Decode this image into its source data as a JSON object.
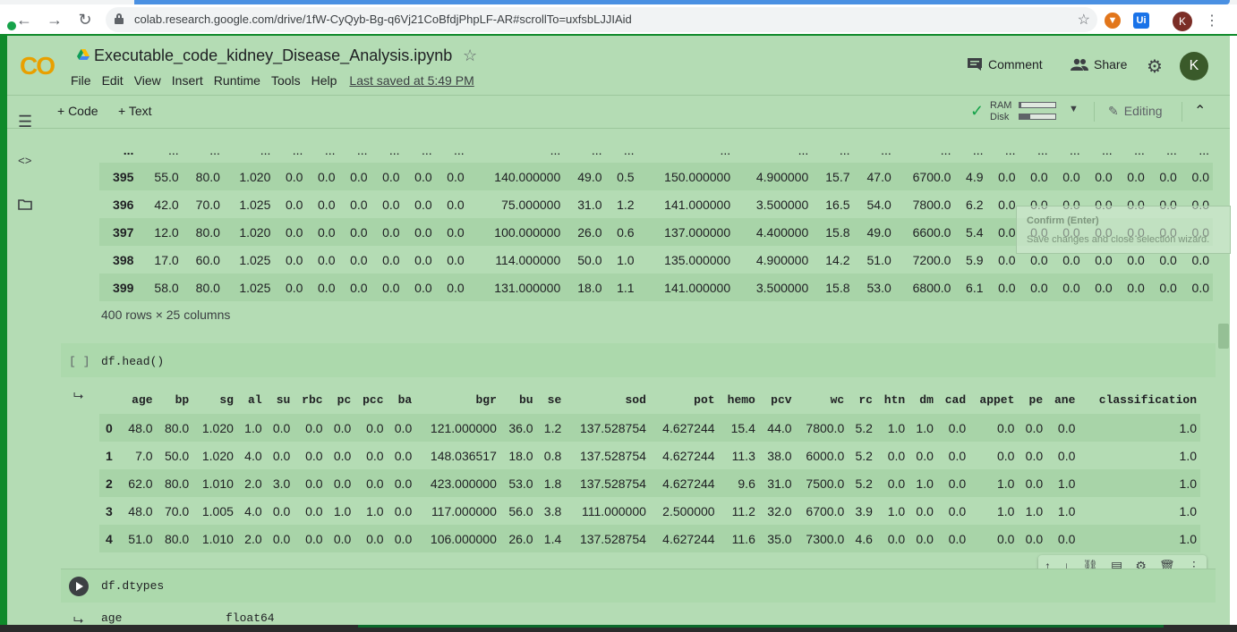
{
  "browser": {
    "url": "colab.research.google.com/drive/1fW-CyQyb-Bg-q6Vj21CoBfdjPhpLF-AR#scrollTo=uxfsbLJJIAid",
    "profile_initial": "K",
    "ext_ui_label": "Ui"
  },
  "header": {
    "logo": "CO",
    "title": "Executable_code_kidney_Disease_Analysis.ipynb",
    "menu": [
      "File",
      "Edit",
      "View",
      "Insert",
      "Runtime",
      "Tools",
      "Help"
    ],
    "last_saved": "Last saved at 5:49 PM",
    "comment_label": "Comment",
    "share_label": "Share",
    "avatar_initial": "K"
  },
  "toolbar": {
    "code_label": "+ Code",
    "text_label": "+ Text",
    "ram_label": "RAM",
    "disk_label": "Disk",
    "ram_fraction": 0.05,
    "disk_fraction": 0.3,
    "editing_label": "Editing"
  },
  "top_output": {
    "ellipsis_row": [
      "...",
      "...",
      "...",
      "...",
      "...",
      "...",
      "...",
      "...",
      "...",
      "...",
      "...",
      "...",
      "...",
      "...",
      "...",
      "...",
      "...",
      "...",
      "...",
      "...",
      "...",
      "...",
      "...",
      "...",
      "...",
      "..."
    ],
    "rows": [
      [
        "395",
        "55.0",
        "80.0",
        "1.020",
        "0.0",
        "0.0",
        "0.0",
        "0.0",
        "0.0",
        "0.0",
        "140.000000",
        "49.0",
        "0.5",
        "150.000000",
        "4.900000",
        "15.7",
        "47.0",
        "6700.0",
        "4.9",
        "0.0",
        "0.0",
        "0.0",
        "0.0",
        "0.0",
        "0.0",
        "0.0"
      ],
      [
        "396",
        "42.0",
        "70.0",
        "1.025",
        "0.0",
        "0.0",
        "0.0",
        "0.0",
        "0.0",
        "0.0",
        "75.000000",
        "31.0",
        "1.2",
        "141.000000",
        "3.500000",
        "16.5",
        "54.0",
        "7800.0",
        "6.2",
        "0.0",
        "0.0",
        "0.0",
        "0.0",
        "0.0",
        "0.0",
        "0.0"
      ],
      [
        "397",
        "12.0",
        "80.0",
        "1.020",
        "0.0",
        "0.0",
        "0.0",
        "0.0",
        "0.0",
        "0.0",
        "100.000000",
        "26.0",
        "0.6",
        "137.000000",
        "4.400000",
        "15.8",
        "49.0",
        "6600.0",
        "5.4",
        "0.0",
        "0.0",
        "0.0",
        "0.0",
        "0.0",
        "0.0",
        "0.0"
      ],
      [
        "398",
        "17.0",
        "60.0",
        "1.025",
        "0.0",
        "0.0",
        "0.0",
        "0.0",
        "0.0",
        "0.0",
        "114.000000",
        "50.0",
        "1.0",
        "135.000000",
        "4.900000",
        "14.2",
        "51.0",
        "7200.0",
        "5.9",
        "0.0",
        "0.0",
        "0.0",
        "0.0",
        "0.0",
        "0.0",
        "0.0"
      ],
      [
        "399",
        "58.0",
        "80.0",
        "1.025",
        "0.0",
        "0.0",
        "0.0",
        "0.0",
        "0.0",
        "0.0",
        "131.000000",
        "18.0",
        "1.1",
        "141.000000",
        "3.500000",
        "15.8",
        "53.0",
        "6800.0",
        "6.1",
        "0.0",
        "0.0",
        "0.0",
        "0.0",
        "0.0",
        "0.0",
        "0.0"
      ]
    ],
    "rows_note": "400 rows × 25 columns"
  },
  "head_cell": {
    "bracket": "[ ]",
    "code": "df.head()",
    "columns": [
      "",
      "age",
      "bp",
      "sg",
      "al",
      "su",
      "rbc",
      "pc",
      "pcc",
      "ba",
      "bgr",
      "bu",
      "se",
      "sod",
      "pot",
      "hemo",
      "pcv",
      "wc",
      "rc",
      "htn",
      "dm",
      "cad",
      "appet",
      "pe",
      "ane",
      "classification"
    ],
    "rows": [
      [
        "0",
        "48.0",
        "80.0",
        "1.020",
        "1.0",
        "0.0",
        "0.0",
        "0.0",
        "0.0",
        "0.0",
        "121.000000",
        "36.0",
        "1.2",
        "137.528754",
        "4.627244",
        "15.4",
        "44.0",
        "7800.0",
        "5.2",
        "1.0",
        "1.0",
        "0.0",
        "0.0",
        "0.0",
        "0.0",
        "1.0"
      ],
      [
        "1",
        "7.0",
        "50.0",
        "1.020",
        "4.0",
        "0.0",
        "0.0",
        "0.0",
        "0.0",
        "0.0",
        "148.036517",
        "18.0",
        "0.8",
        "137.528754",
        "4.627244",
        "11.3",
        "38.0",
        "6000.0",
        "5.2",
        "0.0",
        "0.0",
        "0.0",
        "0.0",
        "0.0",
        "0.0",
        "1.0"
      ],
      [
        "2",
        "62.0",
        "80.0",
        "1.010",
        "2.0",
        "3.0",
        "0.0",
        "0.0",
        "0.0",
        "0.0",
        "423.000000",
        "53.0",
        "1.8",
        "137.528754",
        "4.627244",
        "9.6",
        "31.0",
        "7500.0",
        "5.2",
        "0.0",
        "1.0",
        "0.0",
        "1.0",
        "0.0",
        "1.0",
        "1.0"
      ],
      [
        "3",
        "48.0",
        "70.0",
        "1.005",
        "4.0",
        "0.0",
        "0.0",
        "1.0",
        "1.0",
        "0.0",
        "117.000000",
        "56.0",
        "3.8",
        "111.000000",
        "2.500000",
        "11.2",
        "32.0",
        "6700.0",
        "3.9",
        "1.0",
        "0.0",
        "0.0",
        "1.0",
        "1.0",
        "1.0",
        "1.0"
      ],
      [
        "4",
        "51.0",
        "80.0",
        "1.010",
        "2.0",
        "0.0",
        "0.0",
        "0.0",
        "0.0",
        "0.0",
        "106.000000",
        "26.0",
        "1.4",
        "137.528754",
        "4.627244",
        "11.6",
        "35.0",
        "7300.0",
        "4.6",
        "0.0",
        "0.0",
        "0.0",
        "0.0",
        "0.0",
        "0.0",
        "1.0"
      ]
    ]
  },
  "dtypes_cell": {
    "code": "df.dtypes",
    "first_row_name": "age",
    "first_row_type": "float64"
  },
  "tooltip": {
    "title": "Confirm (Enter)",
    "text": "Save changes and close selection wizard."
  },
  "colors": {
    "background": "#b4dcb4",
    "stripe": "#a8d4a8",
    "frame_green": "#0f8a2a",
    "colab_orange": "#e8a000"
  }
}
